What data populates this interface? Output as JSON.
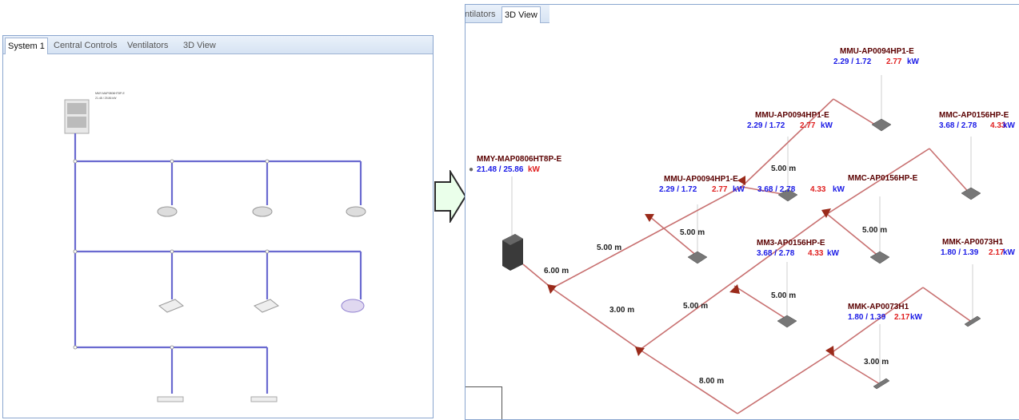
{
  "left_panel": {
    "tabs": [
      "System 1",
      "Central Controls",
      "Ventilators",
      "3D View"
    ],
    "active_tab": 0
  },
  "right_panel": {
    "tabs": [
      "ntilators",
      "3D View"
    ],
    "active_tab": 1,
    "outdoor_unit": {
      "model": "MMY-MAP0806HT8P-E",
      "values": "21.48 / 25.86",
      "unit": "kW"
    },
    "indoor_units": [
      {
        "model": "MMU-AP0094HP1-E",
        "blue": "2.29 / 1.72",
        "red": "2.77",
        "unit": "kW"
      },
      {
        "model": "MMU-AP0094HP1-E",
        "blue": "2.29 / 1.72",
        "red": "2.77",
        "unit": "kW"
      },
      {
        "model": "MMU-AP0094HP1-E",
        "blue": "2.29 / 1.72",
        "red": "2.77",
        "unit": "kW"
      },
      {
        "model": "MMC-AP0156HP-E",
        "blue": "3.68 / 2.78",
        "red": "4.33",
        "unit": "kW"
      },
      {
        "model": "MMC-AP0156HP-E",
        "blue": "3.68 / 2.78",
        "red": "4.33",
        "unit": "kW"
      },
      {
        "model": "MM3-AP0156HP-E",
        "blue": "3.68 / 2.78",
        "red": "4.33",
        "unit": "kW"
      },
      {
        "model": "MMK-AP0073H1",
        "blue": "1.80 / 1.39",
        "red": "2.17",
        "unit": "kW"
      },
      {
        "model": "MMK-AP0073H1",
        "blue": "1.80 / 1.39",
        "red": "2.17",
        "unit": "kW"
      }
    ],
    "pipe_lengths": [
      "6.00 m",
      "5.00 m",
      "5.00 m",
      "5.00 m",
      "5.00 m",
      "3.00 m",
      "5.00 m",
      "5.00 m",
      "3.00 m",
      "8.00 m"
    ]
  },
  "colors": {
    "pipe_left": "#6a6ad0",
    "pipe_right": "#c87070",
    "blue_value": "#1a1ae6",
    "red_value": "#e02020",
    "arrow_fill": "#eaffea",
    "arrow_stroke": "#2a2a2a"
  }
}
